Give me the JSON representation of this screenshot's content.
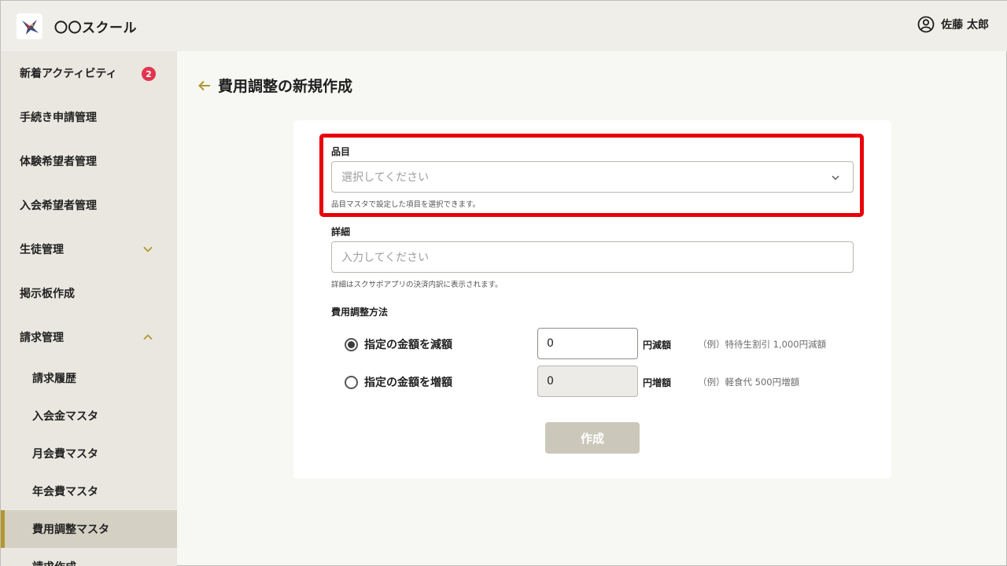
{
  "header": {
    "app_title": "〇〇スクール",
    "user_name": "佐藤 太郎"
  },
  "sidebar": {
    "items": [
      {
        "label": "新着アクティビティ",
        "badge": "2"
      },
      {
        "label": "手続き申請管理"
      },
      {
        "label": "体験希望者管理"
      },
      {
        "label": "入会希望者管理"
      },
      {
        "label": "生徒管理"
      },
      {
        "label": "掲示板作成"
      },
      {
        "label": "請求管理"
      }
    ],
    "sub_items": [
      {
        "label": "請求履歴"
      },
      {
        "label": "入会金マスタ"
      },
      {
        "label": "月会費マスタ"
      },
      {
        "label": "年会費マスタ"
      },
      {
        "label": "費用調整マスタ"
      },
      {
        "label": "請求作成"
      }
    ]
  },
  "main": {
    "page_title": "費用調整の新規作成",
    "form": {
      "item_label": "品目",
      "item_placeholder": "選択してください",
      "item_help": "品目マスタで設定した項目を選択できます。",
      "detail_label": "詳細",
      "detail_placeholder": "入力してください",
      "detail_help": "詳細はスクサポアプリの決済内訳に表示されます。",
      "method_label": "費用調整方法",
      "options": [
        {
          "label": "指定の金額を減額",
          "value": "0",
          "unit": "円減額",
          "example": "（例）特待生割引  1,000円減額",
          "selected": true
        },
        {
          "label": "指定の金額を増額",
          "value": "0",
          "unit": "円増額",
          "example": "（例）軽食代  500円増額",
          "selected": false
        }
      ],
      "submit_label": "作成"
    }
  },
  "colors": {
    "accent": "#b5962e",
    "highlight": "#e8000b",
    "badge": "#e2344f"
  }
}
